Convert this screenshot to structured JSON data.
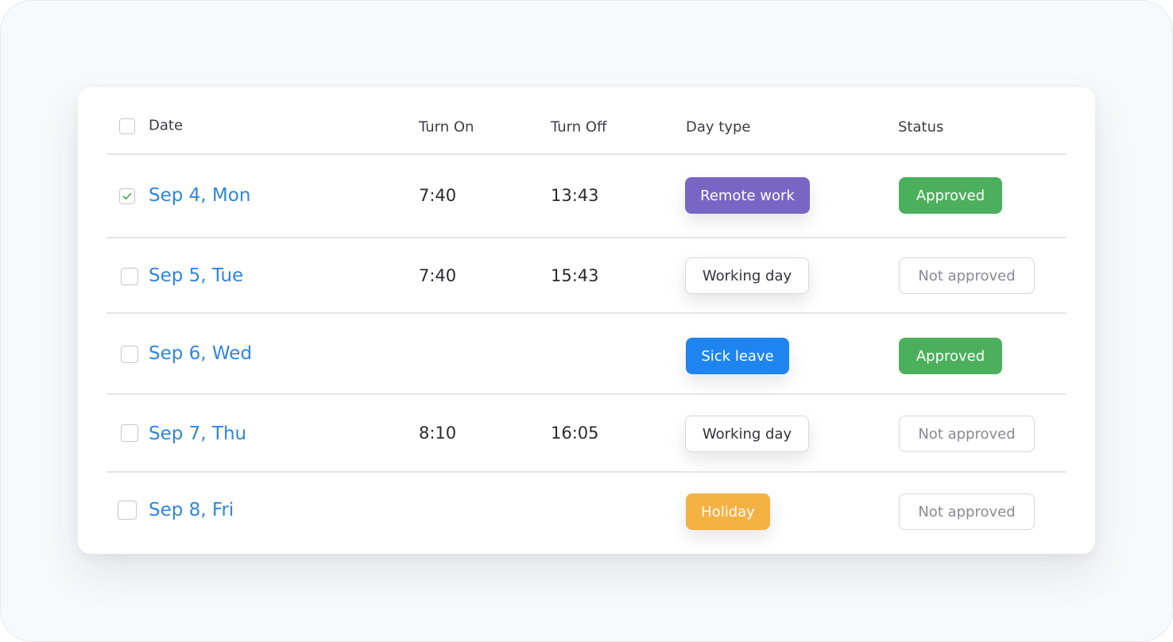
{
  "table": {
    "headers": {
      "date": "Date",
      "turn_on": "Turn On",
      "turn_off": "Turn Off",
      "day_type": "Day type",
      "status": "Status"
    },
    "rows": [
      {
        "date": "Sep 4, Mon",
        "turn_on": "7:40",
        "turn_off": "13:43",
        "day_type": "Remote work",
        "status": "Approved",
        "checked": true
      },
      {
        "date": "Sep 5, Tue",
        "turn_on": "7:40",
        "turn_off": "15:43",
        "day_type": "Working day",
        "status": "Not approved",
        "checked": false
      },
      {
        "date": "Sep 6, Wed",
        "turn_on": "",
        "turn_off": "",
        "day_type": "Sick leave",
        "status": "Approved",
        "checked": false
      },
      {
        "date": "Sep 7, Thu",
        "turn_on": "8:10",
        "turn_off": "16:05",
        "day_type": "Working day",
        "status": "Not approved",
        "checked": false
      },
      {
        "date": "Sep 8, Fri",
        "turn_on": "",
        "turn_off": "",
        "day_type": "Holiday",
        "status": "Not approved",
        "checked": false
      }
    ]
  },
  "colors": {
    "date_link": "#2f86dd",
    "remote_work": "#7866c5",
    "sick_leave": "#1e85f0",
    "holiday": "#f5b143",
    "approved": "#4caf5b",
    "not_approved_text": "#8a8a90",
    "working_day_text": "#333338",
    "check_mark": "#4caf5b"
  }
}
